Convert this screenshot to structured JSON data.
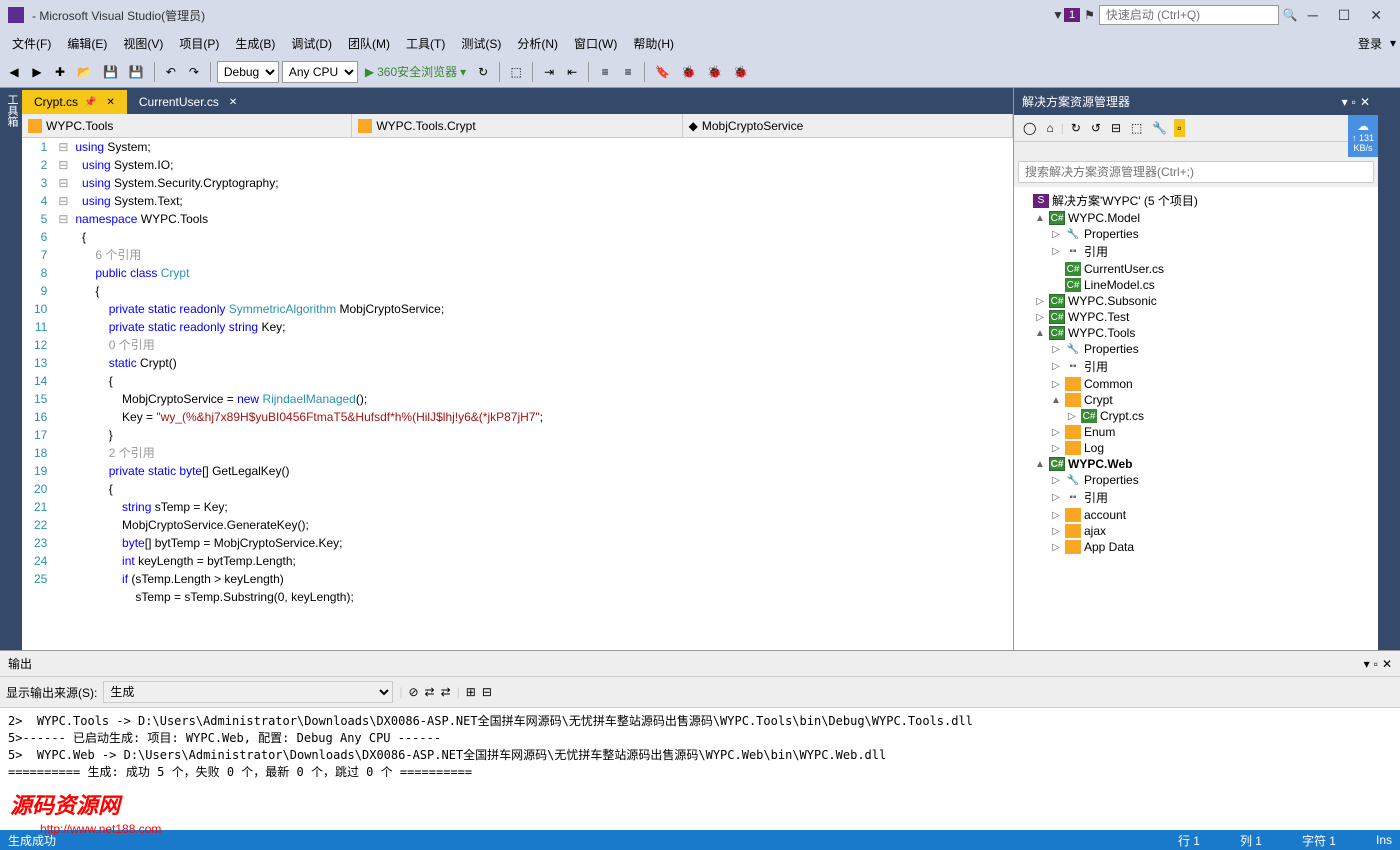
{
  "title": "- Microsoft Visual Studio(管理员)",
  "badge": "1",
  "quickstart_ph": "快速启动 (Ctrl+Q)",
  "menu": [
    "文件(F)",
    "编辑(E)",
    "视图(V)",
    "项目(P)",
    "生成(B)",
    "调试(D)",
    "团队(M)",
    "工具(T)",
    "测试(S)",
    "分析(N)",
    "窗口(W)",
    "帮助(H)"
  ],
  "login": "登录",
  "config": "Debug",
  "platform": "Any CPU",
  "start_label": "360安全浏览器",
  "leftstrip": "工具箱",
  "tabs": [
    {
      "name": "Crypt.cs",
      "active": true,
      "pinned": true
    },
    {
      "name": "CurrentUser.cs",
      "active": false
    }
  ],
  "nav": [
    "WYPC.Tools",
    "WYPC.Tools.Crypt",
    "MobjCryptoService"
  ],
  "code_lines": [
    {
      "n": 1,
      "f": "⊟",
      "t": [
        [
          "kw",
          "using"
        ],
        [
          "op",
          " System;"
        ]
      ]
    },
    {
      "n": 2,
      "f": "",
      "t": [
        [
          "kw",
          "  using"
        ],
        [
          "op",
          " System.IO;"
        ]
      ]
    },
    {
      "n": 3,
      "f": "",
      "t": [
        [
          "kw",
          "  using"
        ],
        [
          "op",
          " System.Security.Cryptography;"
        ]
      ]
    },
    {
      "n": 4,
      "f": "",
      "t": [
        [
          "kw",
          "  using"
        ],
        [
          "op",
          " System.Text;"
        ]
      ]
    },
    {
      "n": 5,
      "f": "",
      "t": [
        [
          "op",
          ""
        ]
      ]
    },
    {
      "n": 6,
      "f": "⊟",
      "t": [
        [
          "kw",
          "namespace"
        ],
        [
          "op",
          " WYPC.Tools"
        ]
      ]
    },
    {
      "n": 7,
      "f": "",
      "t": [
        [
          "op",
          "  {"
        ]
      ]
    },
    {
      "n": "",
      "f": "",
      "t": [
        [
          "cm",
          "      6 个引用"
        ]
      ]
    },
    {
      "n": 8,
      "f": "⊟",
      "t": [
        [
          "op",
          "      "
        ],
        [
          "kw",
          "public class"
        ],
        [
          "op",
          " "
        ],
        [
          "tp",
          "Crypt"
        ]
      ]
    },
    {
      "n": 9,
      "f": "",
      "t": [
        [
          "op",
          "      {"
        ]
      ]
    },
    {
      "n": 10,
      "f": "",
      "t": [
        [
          "op",
          "          "
        ],
        [
          "kw",
          "private static readonly"
        ],
        [
          "op",
          " "
        ],
        [
          "tp",
          "SymmetricAlgorithm"
        ],
        [
          "op",
          " MobjCryptoService;"
        ]
      ]
    },
    {
      "n": 11,
      "f": "",
      "t": [
        [
          "op",
          "          "
        ],
        [
          "kw",
          "private static readonly string"
        ],
        [
          "op",
          " Key;"
        ]
      ]
    },
    {
      "n": "",
      "f": "",
      "t": [
        [
          "cm",
          "          0 个引用"
        ]
      ]
    },
    {
      "n": 12,
      "f": "⊟",
      "t": [
        [
          "op",
          "          "
        ],
        [
          "kw",
          "static"
        ],
        [
          "op",
          " Crypt()"
        ]
      ]
    },
    {
      "n": 13,
      "f": "",
      "t": [
        [
          "op",
          "          {"
        ]
      ]
    },
    {
      "n": 14,
      "f": "",
      "t": [
        [
          "op",
          "              MobjCryptoService = "
        ],
        [
          "kw",
          "new"
        ],
        [
          "op",
          " "
        ],
        [
          "tp",
          "RijndaelManaged"
        ],
        [
          "op",
          "();"
        ]
      ]
    },
    {
      "n": 15,
      "f": "",
      "t": [
        [
          "op",
          "              Key = "
        ],
        [
          "st",
          "\"wy_(%&hj7x89H$yuBI0456FtmaT5&Hufsdf*h%(HilJ$lhj!y6&(*jkP87jH7\""
        ],
        [
          "op",
          ";"
        ]
      ]
    },
    {
      "n": 16,
      "f": "",
      "t": [
        [
          "op",
          "          }"
        ]
      ]
    },
    {
      "n": 17,
      "f": "",
      "t": [
        [
          "op",
          ""
        ]
      ]
    },
    {
      "n": "",
      "f": "",
      "t": [
        [
          "cm",
          "          2 个引用"
        ]
      ]
    },
    {
      "n": 18,
      "f": "⊟",
      "t": [
        [
          "op",
          "          "
        ],
        [
          "kw",
          "private static byte"
        ],
        [
          "op",
          "[] GetLegalKey()"
        ]
      ]
    },
    {
      "n": 19,
      "f": "",
      "t": [
        [
          "op",
          "          {"
        ]
      ]
    },
    {
      "n": 20,
      "f": "",
      "t": [
        [
          "op",
          "              "
        ],
        [
          "kw",
          "string"
        ],
        [
          "op",
          " sTemp = Key;"
        ]
      ]
    },
    {
      "n": 21,
      "f": "",
      "t": [
        [
          "op",
          "              MobjCryptoService.GenerateKey();"
        ]
      ]
    },
    {
      "n": 22,
      "f": "",
      "t": [
        [
          "op",
          "              "
        ],
        [
          "kw",
          "byte"
        ],
        [
          "op",
          "[] bytTemp = MobjCryptoService.Key;"
        ]
      ]
    },
    {
      "n": 23,
      "f": "",
      "t": [
        [
          "op",
          "              "
        ],
        [
          "kw",
          "int"
        ],
        [
          "op",
          " keyLength = bytTemp.Length;"
        ]
      ]
    },
    {
      "n": 24,
      "f": "",
      "t": [
        [
          "op",
          "              "
        ],
        [
          "kw",
          "if"
        ],
        [
          "op",
          " (sTemp.Length > keyLength)"
        ]
      ]
    },
    {
      "n": 25,
      "f": "",
      "t": [
        [
          "op",
          "                  sTemp = sTemp.Substring(0, keyLength);"
        ]
      ]
    }
  ],
  "solution": {
    "title": "解决方案资源管理器",
    "search_ph": "搜索解决方案资源管理器(Ctrl+;)",
    "cloud_rate": "↑ 131 KB/s",
    "root": "解决方案'WYPC' (5 个项目)",
    "nodes": [
      {
        "d": 1,
        "e": "▲",
        "i": "proj",
        "t": "WYPC.Model"
      },
      {
        "d": 2,
        "e": "▷",
        "i": "prop",
        "t": "Properties"
      },
      {
        "d": 2,
        "e": "▷",
        "i": "ref",
        "t": "引用"
      },
      {
        "d": 2,
        "e": "",
        "i": "cs",
        "t": "CurrentUser.cs"
      },
      {
        "d": 2,
        "e": "",
        "i": "cs",
        "t": "LineModel.cs"
      },
      {
        "d": 1,
        "e": "▷",
        "i": "proj",
        "t": "WYPC.Subsonic"
      },
      {
        "d": 1,
        "e": "▷",
        "i": "proj",
        "t": "WYPC.Test"
      },
      {
        "d": 1,
        "e": "▲",
        "i": "proj",
        "t": "WYPC.Tools"
      },
      {
        "d": 2,
        "e": "▷",
        "i": "prop",
        "t": "Properties"
      },
      {
        "d": 2,
        "e": "▷",
        "i": "ref",
        "t": "引用"
      },
      {
        "d": 2,
        "e": "▷",
        "i": "fold",
        "t": "Common"
      },
      {
        "d": 2,
        "e": "▲",
        "i": "fold",
        "t": "Crypt"
      },
      {
        "d": 3,
        "e": "▷",
        "i": "cs",
        "t": "Crypt.cs"
      },
      {
        "d": 2,
        "e": "▷",
        "i": "fold",
        "t": "Enum"
      },
      {
        "d": 2,
        "e": "▷",
        "i": "fold",
        "t": "Log"
      },
      {
        "d": 1,
        "e": "▲",
        "i": "proj",
        "t": "WYPC.Web",
        "bold": true
      },
      {
        "d": 2,
        "e": "▷",
        "i": "prop",
        "t": "Properties"
      },
      {
        "d": 2,
        "e": "▷",
        "i": "ref",
        "t": "引用"
      },
      {
        "d": 2,
        "e": "▷",
        "i": "fold",
        "t": "account"
      },
      {
        "d": 2,
        "e": "▷",
        "i": "fold",
        "t": "ajax"
      },
      {
        "d": 2,
        "e": "▷",
        "i": "fold",
        "t": "App Data"
      }
    ]
  },
  "output": {
    "title": "输出",
    "src_label": "显示输出来源(S):",
    "src_value": "生成",
    "lines": [
      "2>  WYPC.Tools -> D:\\Users\\Administrator\\Downloads\\DX0086-ASP.NET全国拼车网源码\\无忧拼车整站源码出售源码\\WYPC.Tools\\bin\\Debug\\WYPC.Tools.dll",
      "5>------ 已启动生成: 项目: WYPC.Web, 配置: Debug Any CPU ------",
      "5>  WYPC.Web -> D:\\Users\\Administrator\\Downloads\\DX0086-ASP.NET全国拼车网源码\\无忧拼车整站源码出售源码\\WYPC.Web\\bin\\WYPC.Web.dll",
      "========== 生成: 成功 5 个，失败 0 个，最新 0 个，跳过 0 个 =========="
    ]
  },
  "status": {
    "build": "生成成功",
    "line": "行 1",
    "col": "列 1",
    "ch": "字符 1",
    "ins": "Ins"
  },
  "wm1": "源码资源网",
  "wm2": "http://www.net188.com"
}
